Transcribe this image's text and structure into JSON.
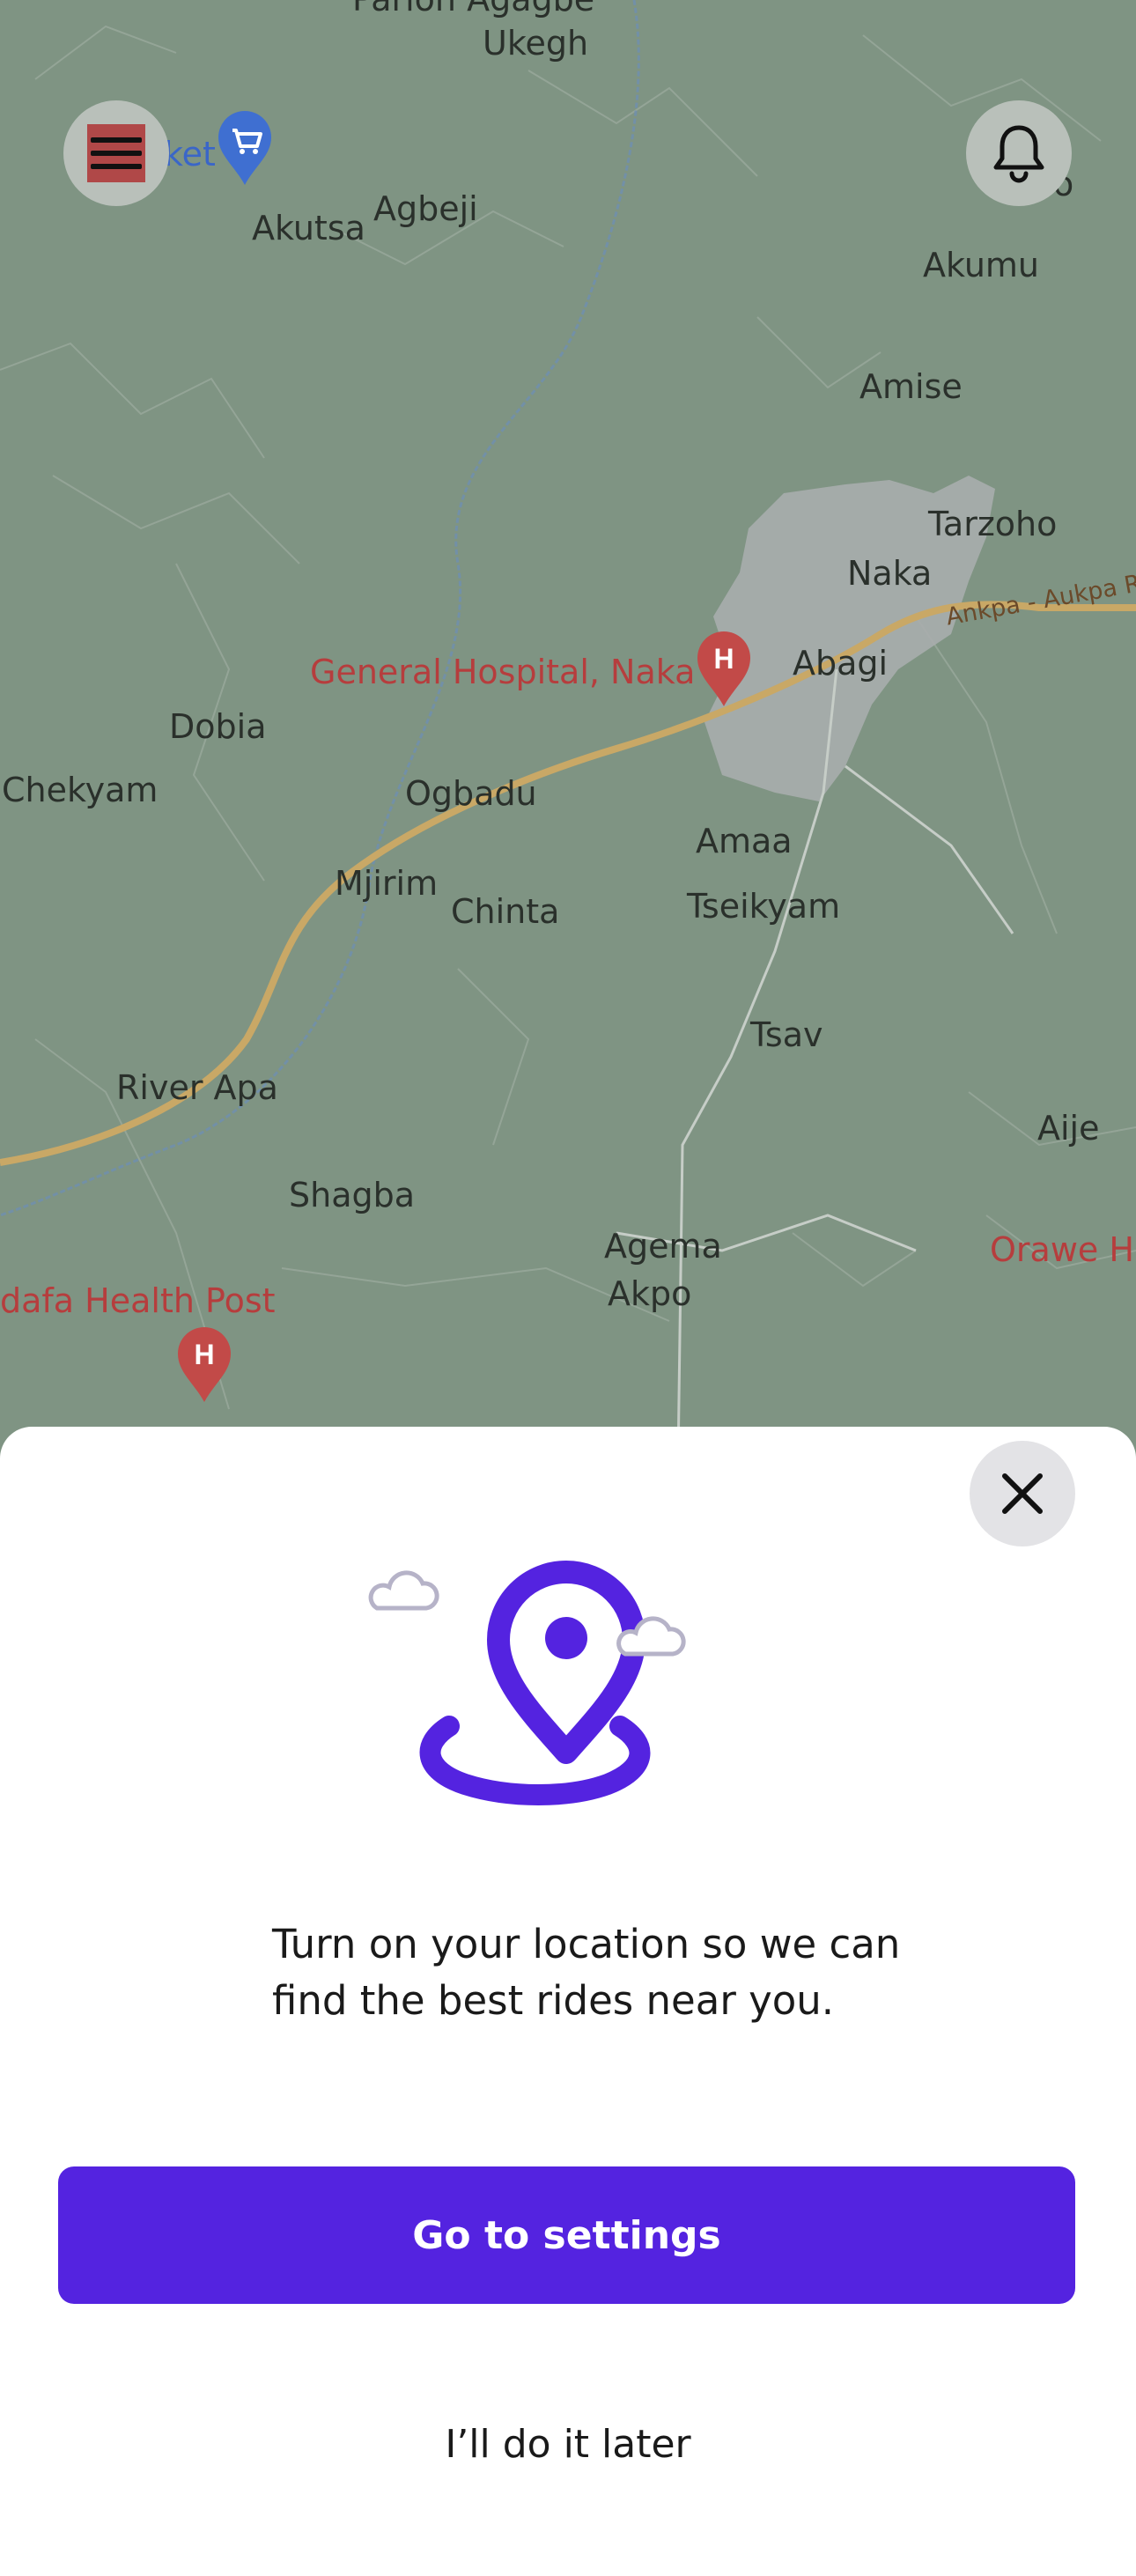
{
  "map": {
    "places": [
      {
        "name": "Ukegh",
        "red": false
      },
      {
        "name": "Akutsa",
        "red": false
      },
      {
        "name": "Agbeji",
        "red": false
      },
      {
        "name": "Akumu",
        "red": false
      },
      {
        "name": "Amise",
        "red": false
      },
      {
        "name": "Tarzoho",
        "red": false
      },
      {
        "name": "Naka",
        "red": false
      },
      {
        "name": "Abagi",
        "red": false
      },
      {
        "name": "General Hospital, Naka",
        "red": true
      },
      {
        "name": "Dobia",
        "red": false
      },
      {
        "name": "Chekyam",
        "red": false
      },
      {
        "name": "Ogbadu",
        "red": false
      },
      {
        "name": "Amaa",
        "red": false
      },
      {
        "name": "Mjirim",
        "red": false
      },
      {
        "name": "Chinta",
        "red": false
      },
      {
        "name": "Tseikyam",
        "red": false
      },
      {
        "name": "Tsav",
        "red": false
      },
      {
        "name": "River Apa",
        "red": false
      },
      {
        "name": "Aije",
        "red": false
      },
      {
        "name": "Shagba",
        "red": false
      },
      {
        "name": "Agema",
        "red": false
      },
      {
        "name": "Akpo",
        "red": false
      },
      {
        "name": "Orawe H",
        "red": true
      },
      {
        "name": "dafa Health Post",
        "red": true
      },
      {
        "name": "ket",
        "red": false
      },
      {
        "name": "Parlon Agagbe",
        "red": false
      },
      {
        "name": "o",
        "red": false
      }
    ],
    "road_name": "Ankpa - Aukpa R",
    "menu_icon": "hamburger-menu-icon",
    "notification_icon": "bell-icon"
  },
  "sheet": {
    "close_icon": "close-icon",
    "illustration_icon": "location-pin-icon",
    "message_line1": "Turn on your location so we can",
    "message_line2": "find the best rides near you.",
    "primary_button": "Go to settings",
    "secondary_link": "I’ll do it later"
  },
  "colors": {
    "accent": "#5423E0",
    "map_background": "#7F9483",
    "sheet_background": "#FFFFFF"
  }
}
